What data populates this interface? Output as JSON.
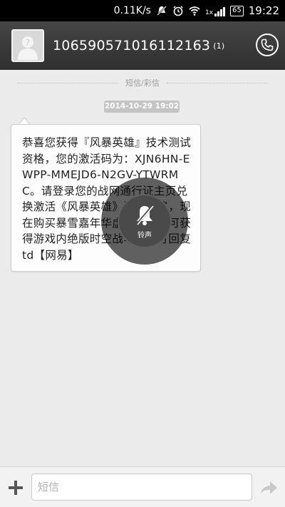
{
  "status_bar": {
    "network_speed": "0.11K/s",
    "signal_label": "1x",
    "battery": "65",
    "time": "19:22"
  },
  "header": {
    "contact": "10659057101611216",
    "contact_tail": "3",
    "message_count": "(1)"
  },
  "thread": {
    "label": "短信/彩信",
    "timestamp": "2014-10-29 19:02"
  },
  "message": {
    "text": "恭喜您获得『风暴英雄』技术测试资格，您的激活码为：XJN6HN-EWPP-MMEJD6-N2GV-YTWRMC。请登录您的战网通行证主页兑换激活《风暴英雄》测试资格，现在购买暴雪嘉年华虚拟门票还可获得游戏内绝版时空战马。退订回复td【网易】"
  },
  "overlay": {
    "ring_label": "铃声"
  },
  "input": {
    "placeholder": "短信"
  },
  "colors": {
    "header_bg": "#3a3a3a",
    "background": "#ebebeb",
    "timestamp_bg": "#c4c4c4"
  }
}
